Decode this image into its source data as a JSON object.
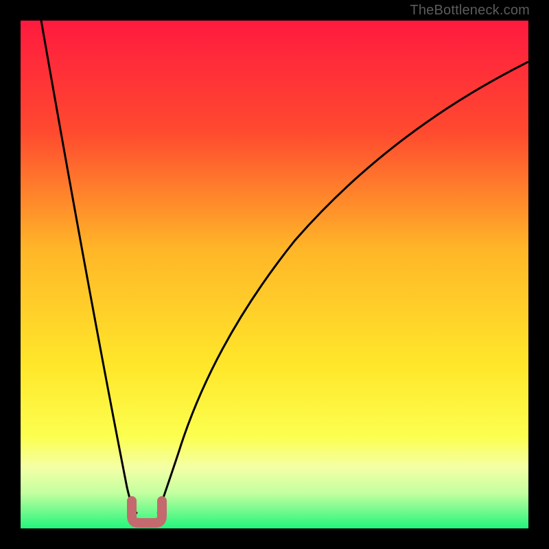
{
  "watermark": "TheBottleneck.com",
  "chart_data": {
    "type": "line",
    "title": "",
    "xlabel": "",
    "ylabel": "",
    "xlim": [
      0,
      100
    ],
    "ylim": [
      0,
      100
    ],
    "grid": false,
    "legend": false,
    "gradient_stops": [
      {
        "offset": 0,
        "color": "#ff1a3f"
      },
      {
        "offset": 22,
        "color": "#ff4a2f"
      },
      {
        "offset": 45,
        "color": "#ffb628"
      },
      {
        "offset": 68,
        "color": "#ffe72a"
      },
      {
        "offset": 82,
        "color": "#fcff50"
      },
      {
        "offset": 88,
        "color": "#f4ffa6"
      },
      {
        "offset": 93,
        "color": "#c4ffa0"
      },
      {
        "offset": 100,
        "color": "#23f57c"
      }
    ],
    "series": [
      {
        "name": "bottleneck-curve-left",
        "x": [
          4,
          6,
          8,
          10,
          12,
          14,
          16,
          18,
          20,
          22,
          23
        ],
        "y": [
          100,
          90,
          80,
          70,
          60,
          50,
          40,
          30,
          20,
          8,
          3
        ]
      },
      {
        "name": "bottleneck-curve-right",
        "x": [
          27,
          29,
          31,
          34,
          38,
          44,
          52,
          62,
          74,
          88,
          100
        ],
        "y": [
          3,
          10,
          20,
          32,
          44,
          56,
          66,
          76,
          84,
          90,
          93
        ]
      }
    ],
    "highlight_marker": {
      "name": "bottleneck-minimum",
      "x_range": [
        22,
        27
      ],
      "y": 3,
      "color": "#c4696d"
    }
  }
}
